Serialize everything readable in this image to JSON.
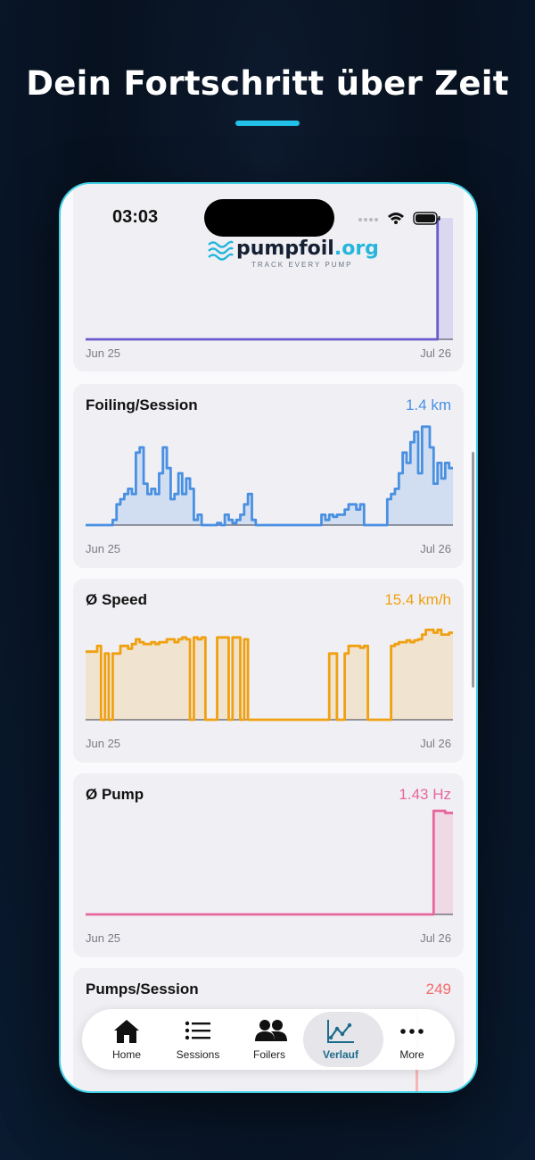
{
  "headline": "Dein Fortschritt über Zeit",
  "status": {
    "time": "03:03"
  },
  "logo": {
    "name": "pumpfoil",
    "tld": ".org",
    "tagline": "TRACK EVERY PUMP"
  },
  "colors": {
    "accent": "#22c1e8",
    "foiling": "#4a90e2",
    "speed": "#f0a010",
    "pump": "#e8659e",
    "pumps": "#f26a6a",
    "tab_active": "#1d6b8a"
  },
  "tabs": [
    {
      "label": "Home",
      "icon": "house-icon"
    },
    {
      "label": "Sessions",
      "icon": "list-icon"
    },
    {
      "label": "Foilers",
      "icon": "people-icon"
    },
    {
      "label": "Verlauf",
      "icon": "chart-icon",
      "active": true
    },
    {
      "label": "More",
      "icon": "ellipsis-icon"
    }
  ],
  "chart_data": [
    {
      "type": "area",
      "title": "",
      "x_start": "Jun 25",
      "x_end": "Jul 26",
      "values": [
        0,
        0,
        0,
        0,
        0,
        0,
        0,
        0,
        0,
        0,
        0,
        0,
        0,
        0,
        0,
        0,
        0,
        0,
        0,
        0,
        0,
        0,
        0,
        0,
        0,
        0,
        0,
        0,
        0,
        0,
        0,
        0,
        0,
        0,
        0,
        0,
        0,
        0,
        0,
        0,
        0,
        0,
        0,
        0,
        0,
        0,
        0,
        0,
        0,
        0,
        0,
        0,
        0,
        0,
        0,
        0,
        0,
        0,
        0,
        0,
        0,
        0,
        0,
        0,
        0,
        0,
        0,
        0,
        0,
        0,
        0,
        0,
        0,
        0,
        0,
        0,
        0,
        0,
        0,
        0,
        0,
        0,
        0,
        0,
        0,
        0,
        0,
        0,
        0,
        0,
        0,
        1,
        1,
        1,
        1
      ]
    },
    {
      "type": "area",
      "title": "Foiling/Session",
      "value": "1.4 km",
      "x_start": "Jun 25",
      "x_end": "Jul 26",
      "values": [
        0,
        0,
        0,
        0,
        0,
        0,
        0,
        0.05,
        0.2,
        0.25,
        0.3,
        0.35,
        0.3,
        0.7,
        0.75,
        0.4,
        0.3,
        0.35,
        0.3,
        0.5,
        0.75,
        0.55,
        0.25,
        0.3,
        0.5,
        0.3,
        0.45,
        0.35,
        0.05,
        0.1,
        0,
        0,
        0,
        0,
        0.02,
        0,
        0.1,
        0.05,
        0.02,
        0.05,
        0.1,
        0.2,
        0.3,
        0.05,
        0,
        0,
        0,
        0,
        0,
        0,
        0,
        0,
        0,
        0,
        0,
        0,
        0,
        0,
        0,
        0,
        0,
        0.1,
        0.05,
        0.1,
        0.08,
        0.1,
        0.1,
        0.15,
        0.2,
        0.2,
        0.15,
        0.2,
        0,
        0,
        0,
        0,
        0,
        0,
        0.25,
        0.3,
        0.35,
        0.5,
        0.7,
        0.6,
        0.8,
        0.9,
        0.5,
        0.95,
        0.95,
        0.75,
        0.4,
        0.6,
        0.45,
        0.6,
        0.55
      ]
    },
    {
      "type": "area",
      "title": "Ø Speed",
      "value": "15.4 km/h",
      "x_start": "Jun 25",
      "x_end": "Jul 26",
      "values": [
        0.72,
        0.72,
        0.72,
        0.78,
        0,
        0.7,
        0,
        0.7,
        0.7,
        0.78,
        0.78,
        0.75,
        0.8,
        0.85,
        0.82,
        0.8,
        0.8,
        0.82,
        0.8,
        0.82,
        0.82,
        0.85,
        0.85,
        0.82,
        0.85,
        0.87,
        0.85,
        0,
        0.87,
        0.85,
        0.87,
        0,
        0,
        0,
        0.87,
        0.87,
        0.87,
        0,
        0.87,
        0.87,
        0,
        0.85,
        0,
        0,
        0,
        0,
        0,
        0,
        0,
        0,
        0,
        0,
        0,
        0,
        0,
        0,
        0,
        0,
        0,
        0,
        0,
        0,
        0,
        0.7,
        0.7,
        0,
        0,
        0.7,
        0.78,
        0.78,
        0.78,
        0.76,
        0.78,
        0,
        0,
        0,
        0,
        0,
        0,
        0.78,
        0.8,
        0.82,
        0.82,
        0.84,
        0.82,
        0.84,
        0.85,
        0.9,
        0.95,
        0.95,
        0.92,
        0.95,
        0.9,
        0.9,
        0.92
      ]
    },
    {
      "type": "area",
      "title": "Ø Pump",
      "value": "1.43 Hz",
      "x_start": "Jun 25",
      "x_end": "Jul 26",
      "values": [
        0,
        0,
        0,
        0,
        0,
        0,
        0,
        0,
        0,
        0,
        0,
        0,
        0,
        0,
        0,
        0,
        0,
        0,
        0,
        0,
        0,
        0,
        0,
        0,
        0,
        0,
        0,
        0,
        0,
        0,
        0,
        0,
        0,
        0,
        0,
        0,
        0,
        0,
        0,
        0,
        0,
        0,
        0,
        0,
        0,
        0,
        0,
        0,
        0,
        0,
        0,
        0,
        0,
        0,
        0,
        0,
        0,
        0,
        0,
        0,
        0,
        0,
        0,
        0,
        0,
        0,
        0,
        0,
        0,
        0,
        0,
        0,
        0,
        0,
        0,
        0,
        0,
        0,
        0,
        0,
        0,
        0,
        0,
        0,
        0,
        0,
        0,
        0,
        0,
        0,
        1,
        1,
        1,
        0.98,
        0.98
      ]
    },
    {
      "type": "area",
      "title": "Pumps/Session",
      "value": "249"
    }
  ]
}
